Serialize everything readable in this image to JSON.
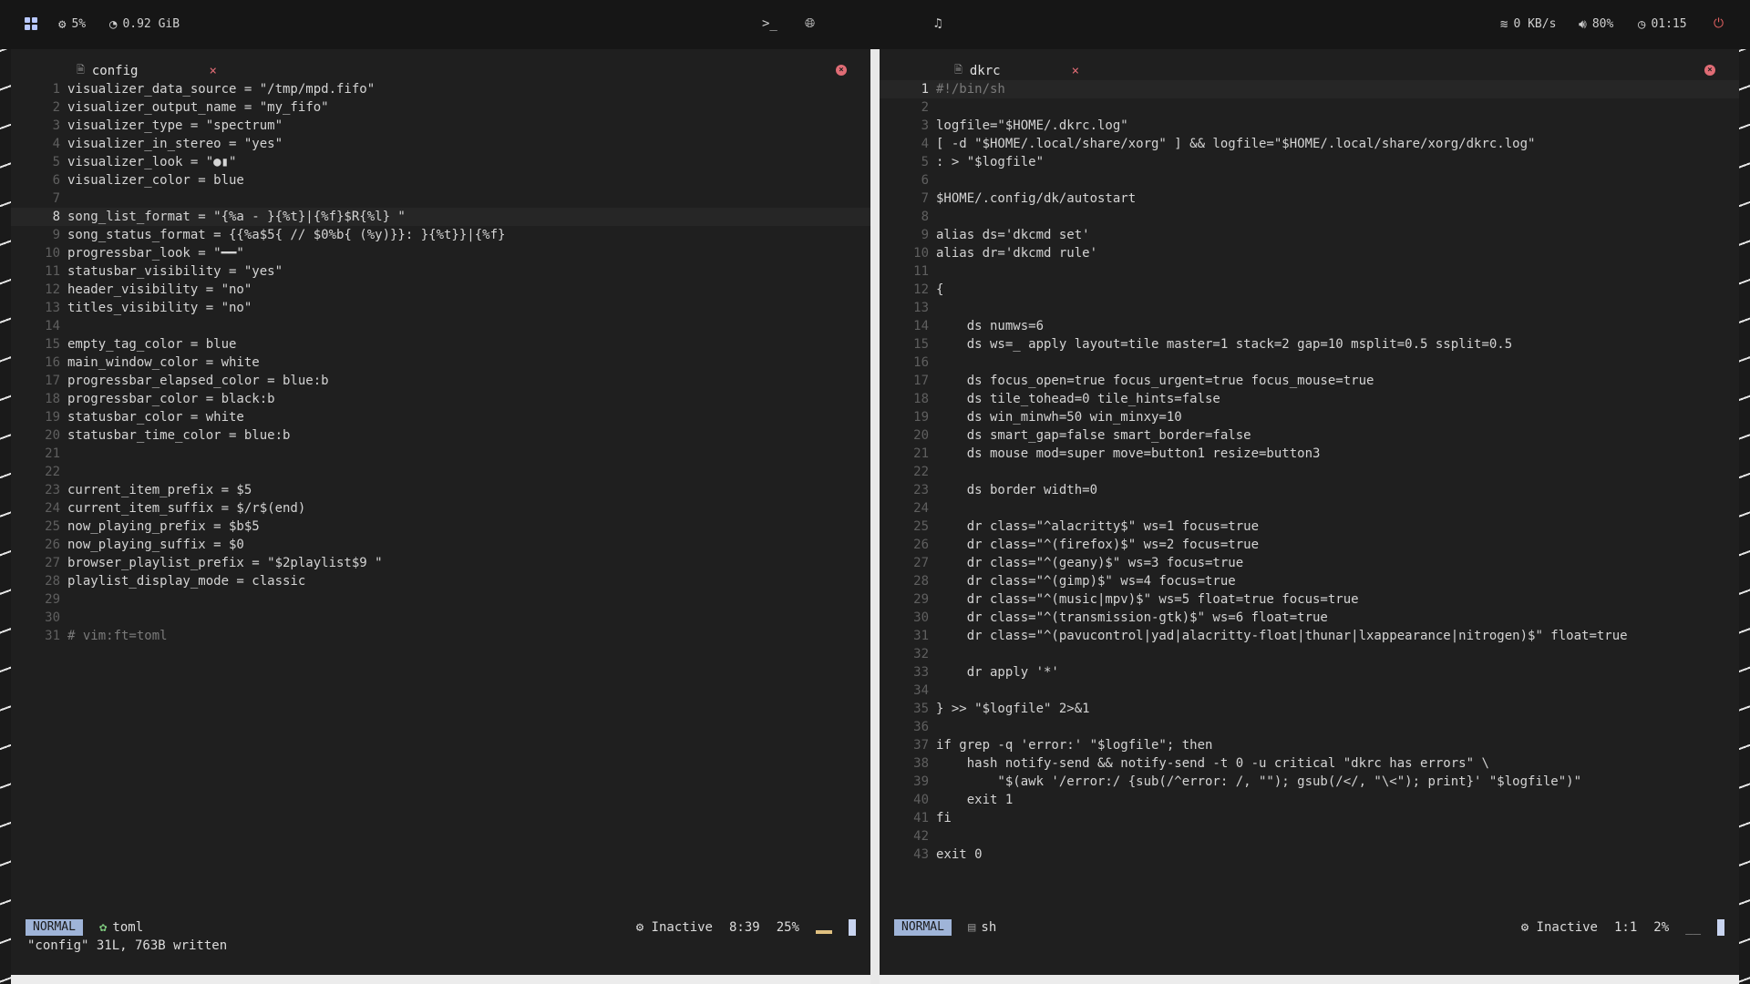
{
  "topbar": {
    "cpu": "5%",
    "mem": "0.92 GiB",
    "net": "0 KB/s",
    "volume": "80%",
    "time": "01:15"
  },
  "left": {
    "tab_name": "config",
    "lines": [
      "visualizer_data_source = \"/tmp/mpd.fifo\"",
      "visualizer_output_name = \"my_fifo\"",
      "visualizer_type = \"spectrum\"",
      "visualizer_in_stereo = \"yes\"",
      "visualizer_look = \"●▮\"",
      "visualizer_color = blue",
      "",
      "song_list_format = \"{%a - }{%t}|{%f}$R{%l} \"",
      "song_status_format = {{%a$5{ // $0%b{ (%y)}}: }{%t}}|{%f}",
      "progressbar_look = \"━━\"",
      "statusbar_visibility = \"yes\"",
      "header_visibility = \"no\"",
      "titles_visibility = \"no\"",
      "",
      "empty_tag_color = blue",
      "main_window_color = white",
      "progressbar_elapsed_color = blue:b",
      "progressbar_color = black:b",
      "statusbar_color = white",
      "statusbar_time_color = blue:b",
      "",
      "",
      "current_item_prefix = $5",
      "current_item_suffix = $/r$(end)",
      "now_playing_prefix = $b$5",
      "now_playing_suffix = $0",
      "browser_playlist_prefix = \"$2playlist$9 \"",
      "playlist_display_mode = classic",
      "",
      "",
      "# vim:ft=toml"
    ],
    "current_line": 8,
    "status": {
      "mode": "NORMAL",
      "filetype": "toml",
      "lsp": "Inactive",
      "position": "8:39",
      "percent": "25%"
    },
    "message": "\"config\" 31L, 763B written"
  },
  "right": {
    "tab_name": "dkrc",
    "lines": [
      "#!/bin/sh",
      "",
      "logfile=\"$HOME/.dkrc.log\"",
      "[ -d \"$HOME/.local/share/xorg\" ] && logfile=\"$HOME/.local/share/xorg/dkrc.log\"",
      ": > \"$logfile\"",
      "",
      "$HOME/.config/dk/autostart",
      "",
      "alias ds='dkcmd set'",
      "alias dr='dkcmd rule'",
      "",
      "{",
      "",
      "    ds numws=6",
      "    ds ws=_ apply layout=tile master=1 stack=2 gap=10 msplit=0.5 ssplit=0.5",
      "",
      "    ds focus_open=true focus_urgent=true focus_mouse=true",
      "    ds tile_tohead=0 tile_hints=false",
      "    ds win_minwh=50 win_minxy=10",
      "    ds smart_gap=false smart_border=false",
      "    ds mouse mod=super move=button1 resize=button3",
      "",
      "    ds border width=0",
      "",
      "    dr class=\"^alacritty$\" ws=1 focus=true",
      "    dr class=\"^(firefox)$\" ws=2 focus=true",
      "    dr class=\"^(geany)$\" ws=3 focus=true",
      "    dr class=\"^(gimp)$\" ws=4 focus=true",
      "    dr class=\"^(music|mpv)$\" ws=5 float=true focus=true",
      "    dr class=\"^(transmission-gtk)$\" ws=6 float=true",
      "    dr class=\"^(pavucontrol|yad|alacritty-float|thunar|lxappearance|nitrogen)$\" float=true",
      "",
      "    dr apply '*'",
      "",
      "} >> \"$logfile\" 2>&1",
      "",
      "if grep -q 'error:' \"$logfile\"; then",
      "    hash notify-send && notify-send -t 0 -u critical \"dkrc has errors\" \\",
      "        \"$(awk '/error:/ {sub(/^error: /, \"\"); gsub(/</, \"\\<\"); print}' \"$logfile\")\"",
      "    exit 1",
      "fi",
      "",
      "exit 0"
    ],
    "current_line": 1,
    "status": {
      "mode": "NORMAL",
      "filetype": "sh",
      "lsp": "Inactive",
      "position": "1:1",
      "percent": "2%"
    }
  }
}
